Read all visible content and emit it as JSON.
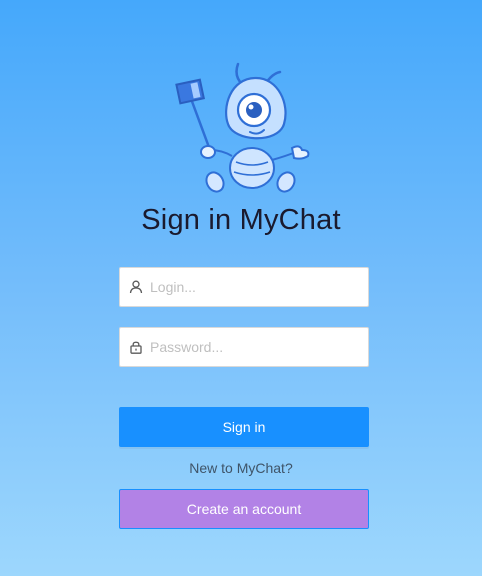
{
  "title": "Sign in MyChat",
  "icons": {
    "mascot": "mascot-logo",
    "user": "user-icon",
    "lock": "lock-icon"
  },
  "form": {
    "login": {
      "placeholder": "Login...",
      "value": ""
    },
    "password": {
      "placeholder": "Password...",
      "value": ""
    },
    "signin_label": "Sign in",
    "new_prompt": "New to MyChat?",
    "create_label": "Create an account"
  },
  "colors": {
    "primary": "#1890ff",
    "create": "#b282e6",
    "background_top": "#45a8fb",
    "background_bottom": "#9dd7fd"
  }
}
